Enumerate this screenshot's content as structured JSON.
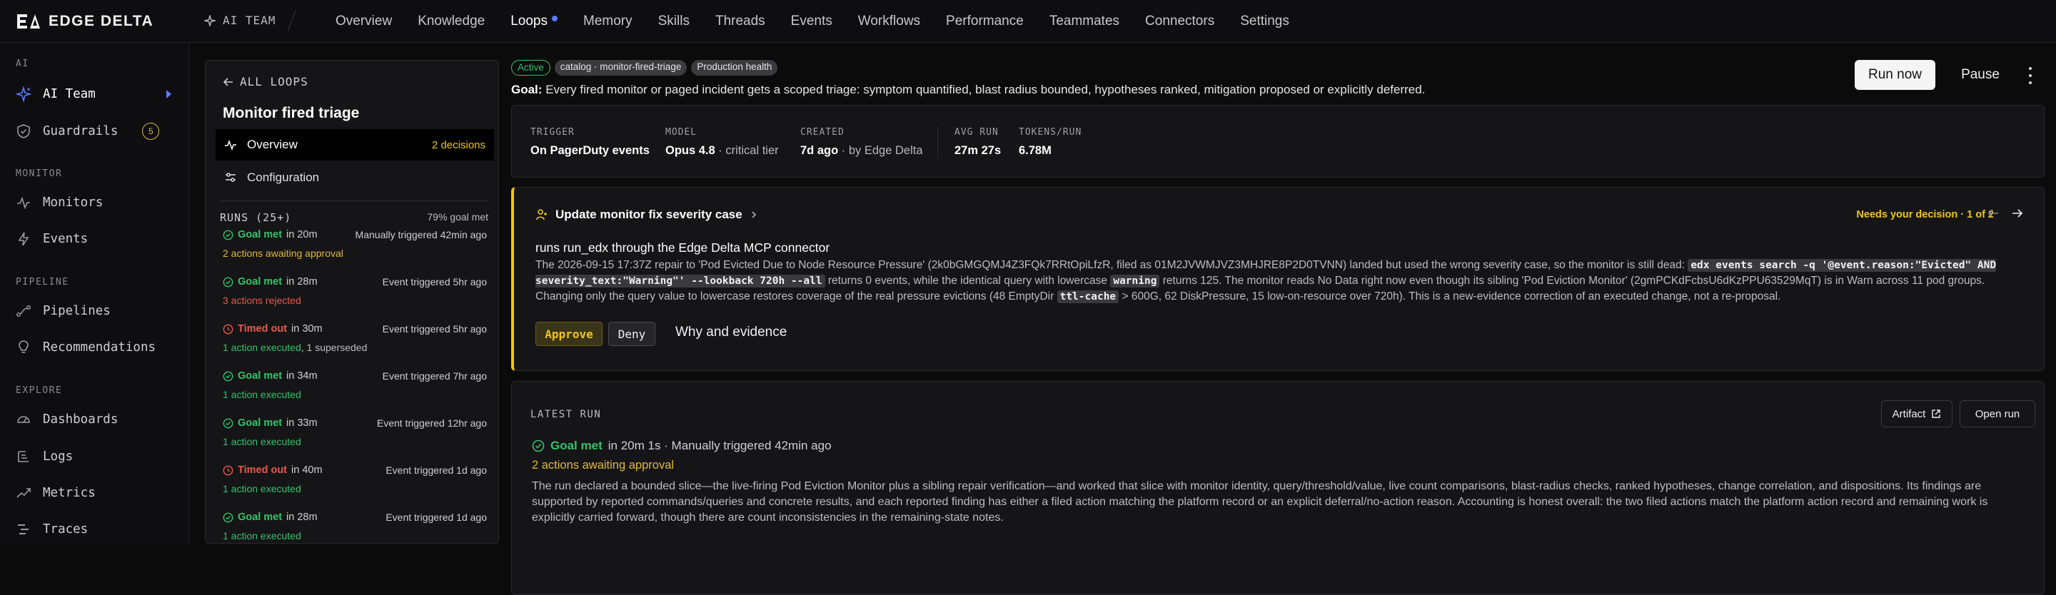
{
  "brand": {
    "name": "EDGE DELTA"
  },
  "breadcrumb": {
    "section": "AI TEAM"
  },
  "nav": [
    {
      "label": "Overview"
    },
    {
      "label": "Knowledge"
    },
    {
      "label": "Loops"
    },
    {
      "label": "Memory"
    },
    {
      "label": "Skills"
    },
    {
      "label": "Threads"
    },
    {
      "label": "Events"
    },
    {
      "label": "Workflows"
    },
    {
      "label": "Performance"
    },
    {
      "label": "Teammates"
    },
    {
      "label": "Connectors"
    },
    {
      "label": "Settings"
    }
  ],
  "nav_active": "Loops",
  "sidebar": {
    "sections": {
      "ai": "AI",
      "monitor": "MONITOR",
      "pipeline": "PIPELINE",
      "explore": "EXPLORE"
    },
    "items": [
      {
        "label": "AI Team",
        "icon": "sparkle-icon"
      },
      {
        "label": "Guardrails",
        "icon": "shield-icon",
        "badge": "5"
      },
      {
        "label": "Monitors",
        "icon": "pulse-icon"
      },
      {
        "label": "Events",
        "icon": "bolt-icon"
      },
      {
        "label": "Pipelines",
        "icon": "pipeline-icon"
      },
      {
        "label": "Recommendations",
        "icon": "lightbulb-icon"
      },
      {
        "label": "Dashboards",
        "icon": "gauge-icon"
      },
      {
        "label": "Logs",
        "icon": "logs-icon"
      },
      {
        "label": "Metrics",
        "icon": "trend-icon"
      },
      {
        "label": "Traces",
        "icon": "traces-icon"
      }
    ]
  },
  "loops_panel": {
    "back_label": "ALL LOOPS",
    "title": "Monitor fired triage",
    "tabs": [
      {
        "label": "Overview",
        "count": "2 decisions"
      },
      {
        "label": "Configuration"
      }
    ],
    "runs_title": "RUNS (25+)",
    "runs_goal": "79% goal met",
    "runs": [
      {
        "status": "Goal met",
        "duration": "in 20m",
        "trigger": "Manually triggered 42min ago",
        "summary": [
          {
            "text": "2 actions awaiting approval",
            "tone": "amber"
          }
        ]
      },
      {
        "status": "Goal met",
        "duration": "in 28m",
        "trigger": "Event triggered 5hr ago",
        "summary": [
          {
            "text": "3 actions rejected",
            "tone": "red"
          }
        ]
      },
      {
        "status": "Timed out",
        "duration": "in 30m",
        "trigger": "Event triggered 5hr ago",
        "summary": [
          {
            "text": "1 action executed",
            "tone": "green"
          },
          {
            "text": ", 1 superseded",
            "tone": "grey"
          }
        ]
      },
      {
        "status": "Goal met",
        "duration": "in 34m",
        "trigger": "Event triggered 7hr ago",
        "summary": [
          {
            "text": "1 action executed",
            "tone": "green"
          }
        ]
      },
      {
        "status": "Goal met",
        "duration": "in 33m",
        "trigger": "Event triggered 12hr ago",
        "summary": [
          {
            "text": "1 action executed",
            "tone": "green"
          }
        ]
      },
      {
        "status": "Timed out",
        "duration": "in 40m",
        "trigger": "Event triggered 1d ago",
        "summary": [
          {
            "text": "1 action executed",
            "tone": "green"
          }
        ]
      },
      {
        "status": "Goal met",
        "duration": "in 28m",
        "trigger": "Event triggered 1d ago",
        "summary": [
          {
            "text": "1 action executed",
            "tone": "green"
          }
        ]
      }
    ]
  },
  "header": {
    "pills": [
      "Active",
      "catalog · monitor-fired-triage",
      "Production health"
    ],
    "goal_label": "Goal:",
    "goal_text": "Every fired monitor or paged incident gets a scoped triage: symptom quantified, blast radius bounded, hypotheses ranked, mitigation proposed or explicitly deferred.",
    "run_now": "Run now",
    "pause": "Pause"
  },
  "meta": {
    "trigger": {
      "label": "TRIGGER",
      "value": "On PagerDuty events"
    },
    "model": {
      "label": "MODEL",
      "value": "Opus 4.8",
      "sub": " · critical tier"
    },
    "created": {
      "label": "CREATED",
      "value": "7d ago",
      "sub": " · by Edge Delta"
    },
    "avg_run": {
      "label": "AVG RUN",
      "value": "27m 27s"
    },
    "tokens": {
      "label": "TOKENS/RUN",
      "value": "6.78M"
    }
  },
  "decision": {
    "title": "Update monitor fix severity case",
    "needs": "Needs your decision · 1 of 2",
    "subtitle": "runs run_edx through the Edge Delta MCP connector",
    "body": {
      "p1": "The 2026-09-15 17:37Z repair to 'Pod Evicted Due to Node Resource Pressure' (2k0bGMGQMJ4Z3FQk7RRtOpiLfzR, filed as 01M2JVWMJVZ3MHJRE8P2D0TVNN) landed but used the wrong severity case, so the monitor is still dead: ",
      "code1": "edx events search -q '@event.reason:\"Evicted\" AND severity_text:\"Warning\"' --lookback 720h --all",
      "p2": " returns 0 events, while the identical query with lowercase ",
      "code2": "warning",
      "p3": " returns 125. The monitor reads No Data right now even though its sibling 'Pod Eviction Monitor' (2gmPCKdFcbsU6dKzPPU63529MqT) is in Warn across 11 pod groups. Changing only the query value to lowercase restores coverage of the real pressure evictions (48 EmptyDir ",
      "code3": "ttl-cache",
      "p4": " > 600G, 62 DiskPressure, 15 low-on-resource over 720h). This is a new-evidence correction of an executed change, not a re-proposal."
    },
    "approve": "Approve",
    "deny": "Deny",
    "why": "Why and evidence"
  },
  "latest_run": {
    "label": "LATEST RUN",
    "artifact": "Artifact",
    "open_run": "Open run",
    "status": "Goal met",
    "detail": "in 20m 1s · Manually triggered 42min ago",
    "awaiting": "2 actions awaiting approval",
    "summary": "The run declared a bounded slice—the live-firing Pod Eviction Monitor plus a sibling repair verification—and worked that slice with monitor identity, query/threshold/value, live count comparisons, blast-radius checks, ranked hypotheses, change correlation, and dispositions. Its findings are supported by reported commands/queries and concrete results, and each reported finding has either a filed action matching the platform record or an explicit deferral/no-action reason. Accounting is honest overall: the two filed actions match the platform action record and remaining work is explicitly carried forward, though there are count inconsistencies in the remaining-state notes."
  },
  "colors": {
    "accent": "#5b7cff",
    "amber": "#f0c419",
    "green": "#35c26a",
    "red": "#e7594d"
  }
}
